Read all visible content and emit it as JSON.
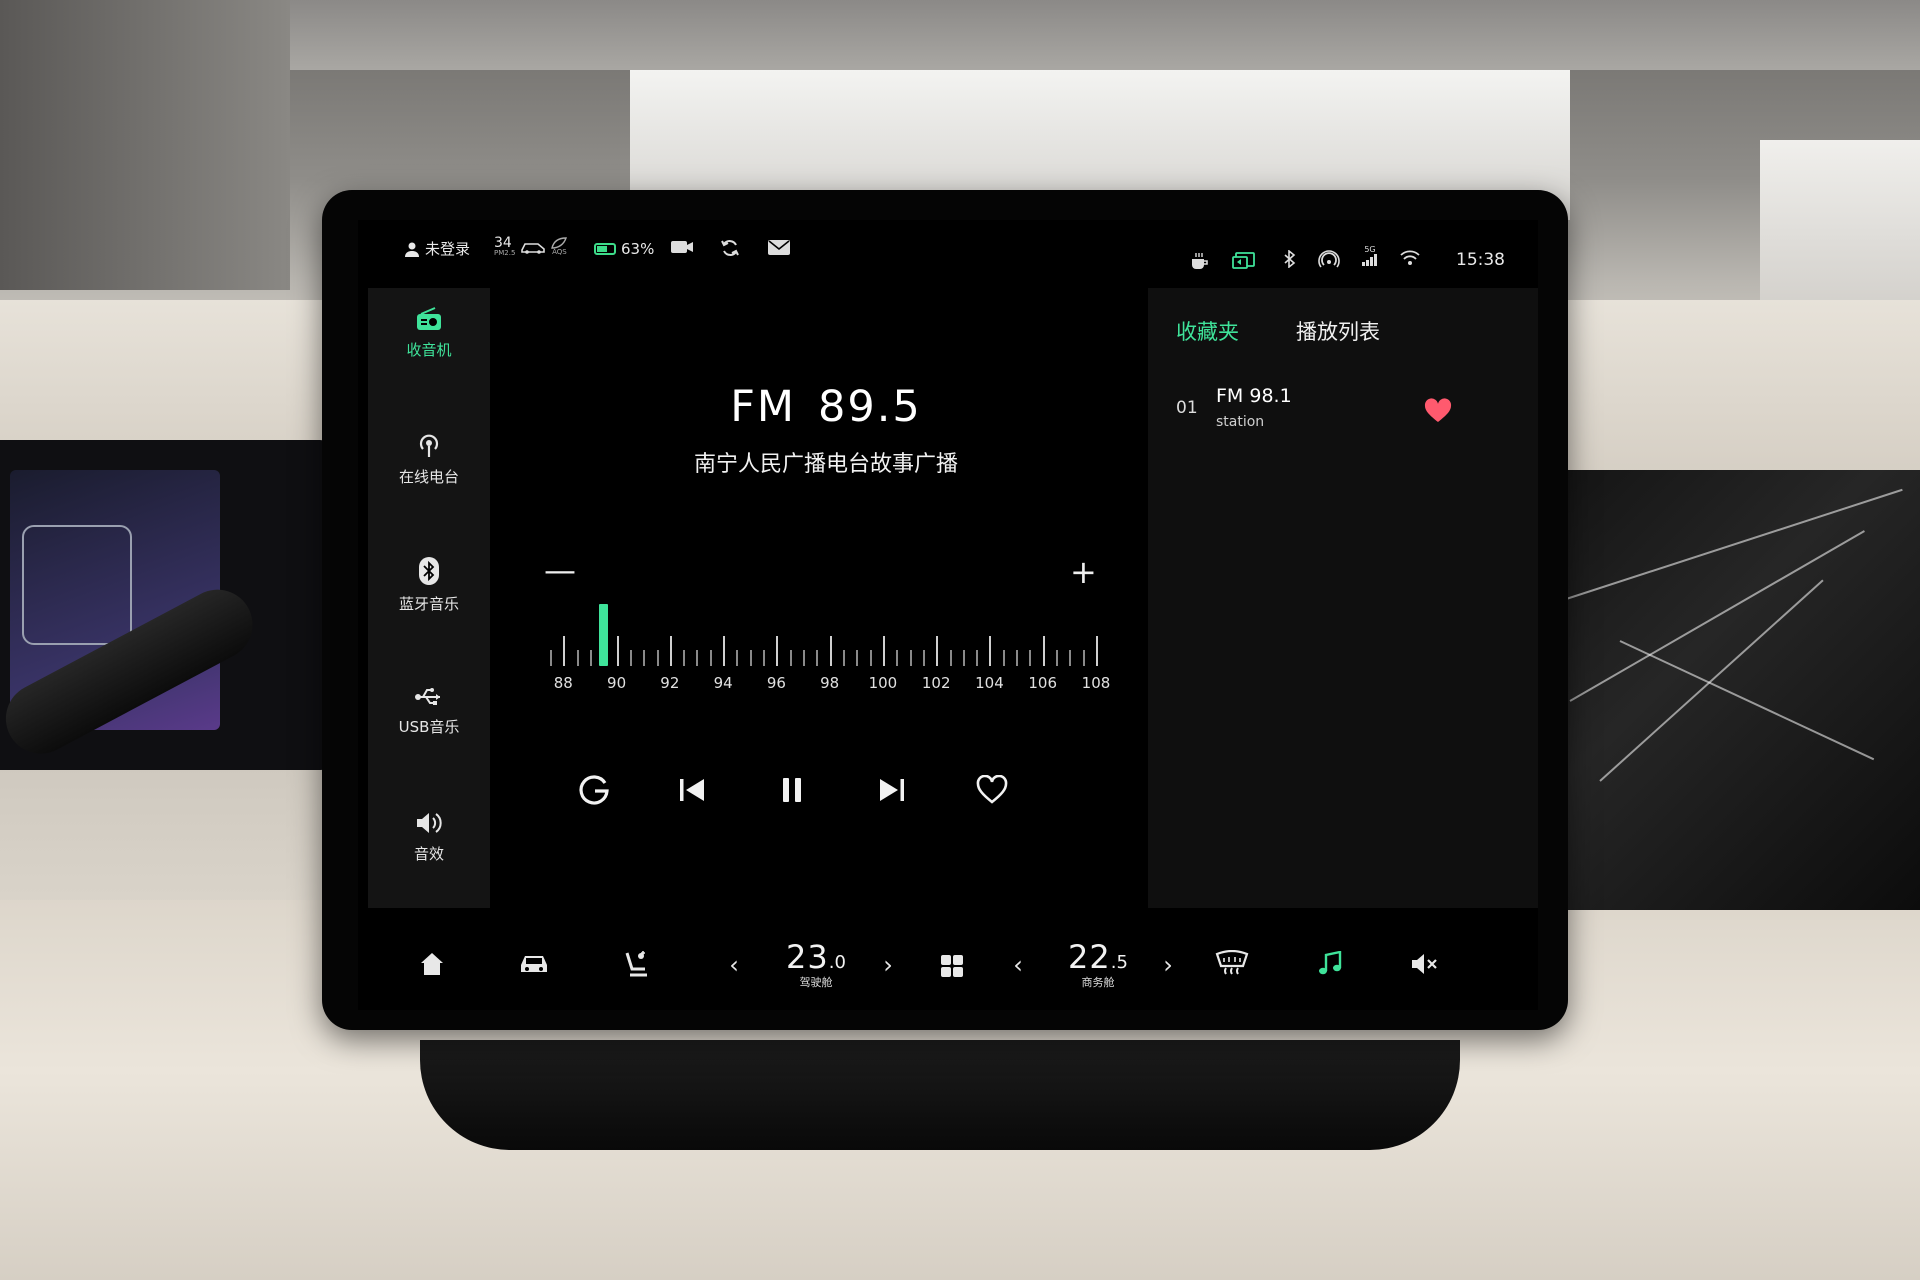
{
  "status_bar": {
    "user_label": "未登录",
    "pm25_value": "34",
    "pm25_unit": "PM2.5",
    "aqs_label": "AQS",
    "battery_percent": "63%",
    "time": "15:38",
    "signal_label": "5G"
  },
  "sidebar": {
    "items": [
      {
        "label": "收音机",
        "icon": "radio-icon",
        "active": true
      },
      {
        "label": "在线电台",
        "icon": "broadcast-icon",
        "active": false
      },
      {
        "label": "蓝牙音乐",
        "icon": "bluetooth-icon",
        "active": false
      },
      {
        "label": "USB音乐",
        "icon": "usb-icon",
        "active": false
      },
      {
        "label": "音效",
        "icon": "speaker-icon",
        "active": false
      }
    ]
  },
  "radio": {
    "band": "FM",
    "frequency": "89.5",
    "station_name": "南宁人民广播电台故事广播",
    "dial_min": 87.5,
    "dial_max": 108,
    "current_value": 89.5,
    "tick_labels": [
      "88",
      "90",
      "92",
      "94",
      "96",
      "98",
      "100",
      "102",
      "104",
      "106",
      "108"
    ]
  },
  "right_panel": {
    "tabs": [
      {
        "label": "收藏夹",
        "active": true
      },
      {
        "label": "播放列表",
        "active": false
      }
    ],
    "favorites": [
      {
        "index": "01",
        "frequency": "FM 98.1",
        "subtitle": "station"
      }
    ]
  },
  "bottom_bar": {
    "driver_temp_int": "23",
    "driver_temp_dec": "0",
    "driver_label": "驾驶舱",
    "rear_temp_int": "22",
    "rear_temp_dec": "5",
    "rear_label": "商务舱"
  },
  "colors": {
    "accent": "#3fe39a",
    "heart": "#ff5a6e",
    "screen_bg": "#000000",
    "panel_bg": "#0f0f0f"
  }
}
